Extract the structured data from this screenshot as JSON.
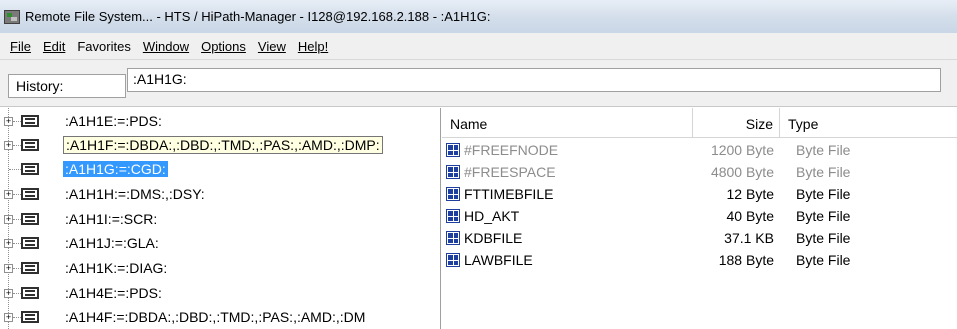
{
  "window": {
    "title": "Remote File System... - HTS / HiPath-Manager - I128@192.168.2.188 - :A1H1G:"
  },
  "menu": [
    {
      "label": "File"
    },
    {
      "label": "Edit"
    },
    {
      "label": "Favorites"
    },
    {
      "label": "Window"
    },
    {
      "label": "Options"
    },
    {
      "label": "View"
    },
    {
      "label": "Help!"
    }
  ],
  "history": {
    "label": "History:",
    "value": ":A1H1G:"
  },
  "tree": {
    "nodes": [
      {
        "label": ":A1H1E:=:PDS:",
        "state": "normal"
      },
      {
        "label": ":A1H1F:=:DBDA:,:DBD:,:TMD:,:PAS:,:AMD:,:DMP:",
        "state": "hovered"
      },
      {
        "label": ":A1H1G:=:CGD:",
        "state": "selected"
      },
      {
        "label": ":A1H1H:=:DMS:,:DSY:",
        "state": "normal"
      },
      {
        "label": ":A1H1I:=:SCR:",
        "state": "normal"
      },
      {
        "label": ":A1H1J:=:GLA:",
        "state": "normal"
      },
      {
        "label": ":A1H1K:=:DIAG:",
        "state": "normal"
      },
      {
        "label": ":A1H4E:=:PDS:",
        "state": "normal"
      },
      {
        "label": ":A1H4F:=:DBDA:,:DBD:,:TMD:,:PAS:,:AMD:,:DM",
        "state": "normal"
      }
    ]
  },
  "file_list": {
    "columns": {
      "name": "Name",
      "size": "Size",
      "type": "Type"
    },
    "rows": [
      {
        "name": "#FREEFNODE",
        "size": "1200 Byte",
        "type": "Byte File",
        "dimmed": true
      },
      {
        "name": "#FREESPACE",
        "size": "4800 Byte",
        "type": "Byte File",
        "dimmed": true
      },
      {
        "name": "FTTIMEBFILE",
        "size": "12 Byte",
        "type": "Byte File",
        "dimmed": false
      },
      {
        "name": "HD_AKT",
        "size": "40 Byte",
        "type": "Byte File",
        "dimmed": false
      },
      {
        "name": "KDBFILE",
        "size": "37.1 KB",
        "type": "Byte File",
        "dimmed": false
      },
      {
        "name": "LAWBFILE",
        "size": "188 Byte",
        "type": "Byte File",
        "dimmed": false
      }
    ]
  },
  "colors": {
    "selection": "#3399ff",
    "tooltip": "#ffffe1",
    "dimmed_text": "#8c8c8c",
    "icon_blue": "#1f3f9f"
  },
  "icons": {
    "app": "app-icon",
    "tree_node": "folder-icon",
    "file": "byte-file-icon",
    "expander": "plus-expander-icon"
  }
}
